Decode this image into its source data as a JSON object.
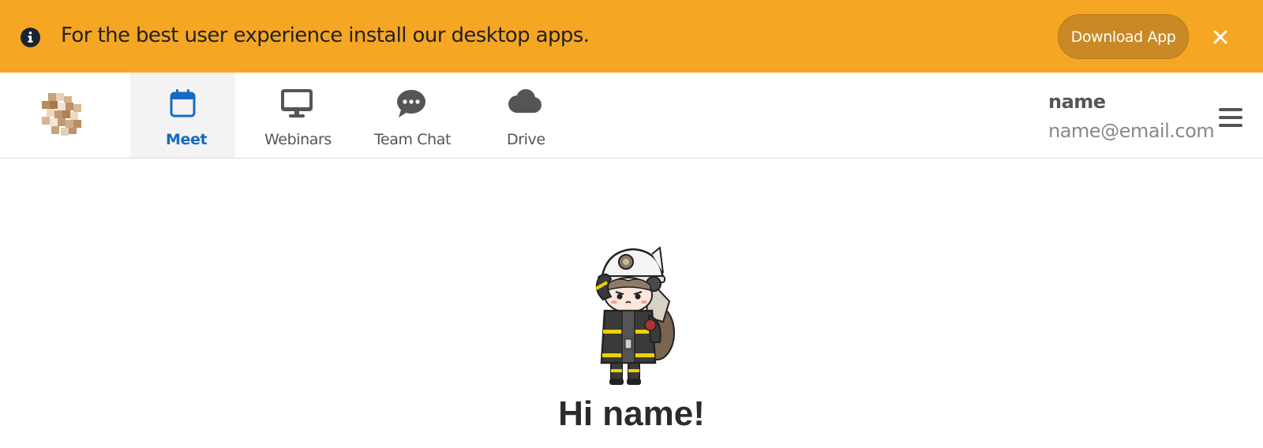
{
  "banner": {
    "message": "For the best user experience install our desktop apps.",
    "download_label": "Download App",
    "icon": "info-icon",
    "close_icon": "close-icon",
    "background_color": "#f5a623",
    "button_color": "#c98924"
  },
  "nav": {
    "tabs": [
      {
        "label": "Meet",
        "icon": "calendar-icon",
        "active": true
      },
      {
        "label": "Webinars",
        "icon": "monitor-icon",
        "active": false
      },
      {
        "label": "Team Chat",
        "icon": "chat-bubble-icon",
        "active": false
      },
      {
        "label": "Drive",
        "icon": "cloud-icon",
        "active": false
      }
    ],
    "active_color": "#1769c4"
  },
  "user": {
    "name": "name",
    "email": "name@email.com"
  },
  "main": {
    "greeting": "Hi name!"
  }
}
